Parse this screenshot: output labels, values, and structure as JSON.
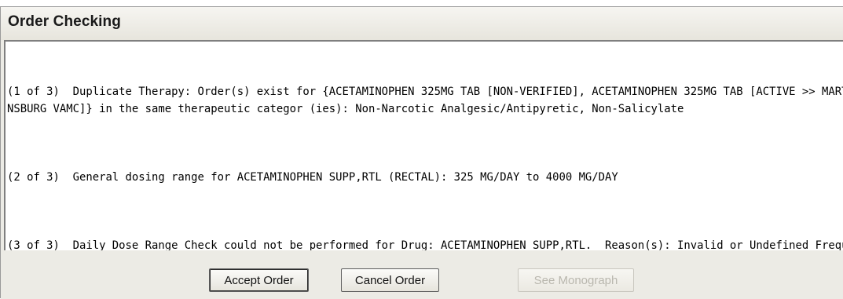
{
  "window": {
    "title": "Order Checking"
  },
  "messages": [
    "(1 of 3)  Duplicate Therapy: Order(s) exist for {ACETAMINOPHEN 325MG TAB [NON-VERIFIED], ACETAMINOPHEN 325MG TAB [ACTIVE >> MARTINSBURG VAMC]} in the same therapeutic categor (ies): Non-Narcotic Analgesic/Antipyretic, Non-Salicylate",
    "(2 of 3)  General dosing range for ACETAMINOPHEN SUPP,RTL (RECTAL): 325 MG/DAY to 4000 MG/DAY",
    "(3 of 3)  Daily Dose Range Check could not be performed for Drug: ACETAMINOPHEN SUPP,RTL.  Reason(s): Invalid or Undefined Frequency"
  ],
  "buttons": {
    "accept": "Accept Order",
    "cancel": "Cancel Order",
    "monograph": "See Monograph"
  }
}
